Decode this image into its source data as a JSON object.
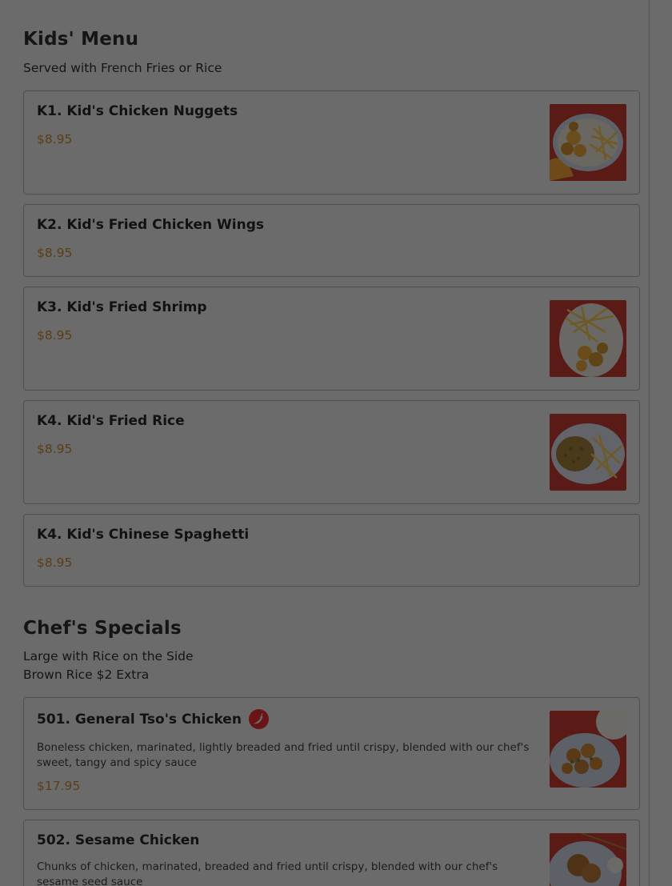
{
  "kids": {
    "title": "Kids' Menu",
    "subtitle": "Served with French Fries or Rice",
    "items": [
      {
        "name": "K1. Kid's Chicken Nuggets",
        "price": "$8.95"
      },
      {
        "name": "K2. Kid's Fried Chicken Wings",
        "price": "$8.95"
      },
      {
        "name": "K3. Kid's Fried Shrimp",
        "price": "$8.95"
      },
      {
        "name": "K4. Kid's Fried Rice",
        "price": "$8.95"
      },
      {
        "name": "K4. Kid's Chinese Spaghetti",
        "price": "$8.95"
      }
    ]
  },
  "chefs": {
    "title": "Chef's Specials",
    "subtitle_1": "Large with Rice on the Side",
    "subtitle_2": "Brown Rice $2 Extra",
    "items": [
      {
        "name": "501. General Tso's Chicken",
        "desc": "Boneless chicken, marinated, lightly breaded and fried until crispy, blended with our chef's sweet, tangy and spicy sauce",
        "price": "$17.95",
        "icon": "chili-pepper-icon"
      },
      {
        "name": "502. Sesame Chicken",
        "desc": "Chunks of chicken, marinated, breaded and fried until crispy, blended with our chef's sesame seed sauce"
      }
    ]
  },
  "colors": {
    "overlay": "#6b6b6b",
    "price": "#5c3e14",
    "spicy": "#6a1515"
  }
}
